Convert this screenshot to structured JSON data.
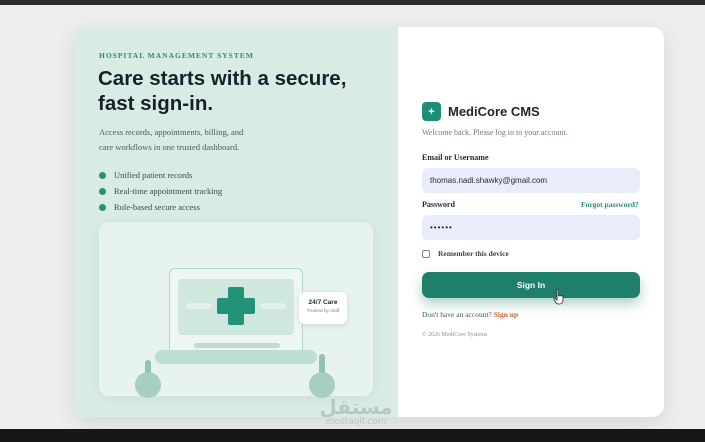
{
  "hero": {
    "eyebrow": "HOSPITAL MANAGEMENT SYSTEM",
    "headline_line1": "Care starts with a secure,",
    "headline_line2": "fast sign-in.",
    "sub_line1": "Access records, appointments, billing, and",
    "sub_line2": "care workflows in one trusted dashboard.",
    "features": [
      "Unified patient records",
      "Real-time appointment tracking",
      "Role-based secure access"
    ],
    "badge_title": "24/7 Care",
    "badge_sub": "Trusted by staff"
  },
  "form": {
    "logo_glyph": "+",
    "brand": "MediCore CMS",
    "welcome": "Welcome back. Please log in to your account.",
    "username_label": "Email or Username",
    "username_value": "thomas.nadi.shawky@gmail.com",
    "password_label": "Password",
    "password_value": "••••••",
    "forgot": "Forgot password?",
    "remember": "Remember this device",
    "remember_checked": false,
    "signin": "Sign In",
    "signup_prompt": "Don't have an account?",
    "signup_link": "Sign up",
    "copyright": "© 2026 MediCore Systems"
  },
  "watermark": {
    "arabic": "مستقل",
    "latin": "mostaqil.com"
  },
  "colors": {
    "accent": "#1e7f6a",
    "panel": "#d8ece5",
    "link": "#c8642b"
  },
  "icons": {
    "logo": "plus-icon",
    "cursor": "hand-pointer-icon"
  }
}
